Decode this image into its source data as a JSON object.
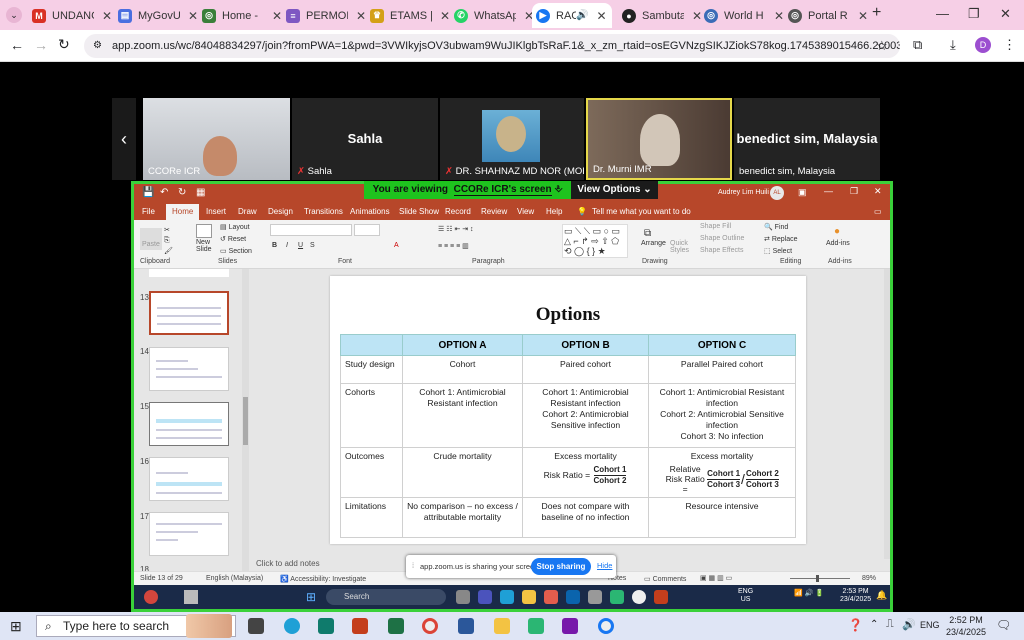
{
  "browser": {
    "tabs": [
      {
        "label": "UNDANG",
        "icon": "gmail-icon",
        "color": "#d93025"
      },
      {
        "label": "MyGovU",
        "icon": "doc-icon",
        "color": "#4a6ee0"
      },
      {
        "label": "Home -",
        "icon": "globe-icon",
        "color": "#3a7f3a"
      },
      {
        "label": "PERMOH",
        "icon": "forms-icon",
        "color": "#7e57c2"
      },
      {
        "label": "ETAMS |",
        "icon": "crown-icon",
        "color": "#d4a017"
      },
      {
        "label": "WhatsAp",
        "icon": "whatsapp-icon",
        "color": "#25d366"
      },
      {
        "label": "RACI",
        "icon": "zoom-icon",
        "color": "#1877f2"
      },
      {
        "label": "Sambuta",
        "icon": "github-icon",
        "color": "#222222"
      },
      {
        "label": "World H",
        "icon": "globe-icon",
        "color": "#3b6cb7"
      },
      {
        "label": "Portal R",
        "icon": "globe-icon",
        "color": "#555555"
      }
    ],
    "new_tab": "+",
    "url": "app.zoom.us/wc/84048834297/join?fromPWA=1&pwd=3VWIkyjsOV3ubwam9WuJIKlgbTsRaF.1&_x_zm_rtaid=osEGVNzgSIKJZiokS78kog.1745389015466.2c003cf0414f88e...",
    "profile_initial": "D"
  },
  "zoom": {
    "participants": [
      {
        "name": "CCORe ICR",
        "big": ""
      },
      {
        "name": "Sahla",
        "big": "Sahla"
      },
      {
        "name": "DR. SHAHNAZ MD NOR (MOH)",
        "big": ""
      },
      {
        "name": "Dr. Murni IMR",
        "big": ""
      },
      {
        "name": "benedict sim, Malaysia",
        "big": "benedict sim, Malaysia"
      }
    ],
    "banner_prefix": "You are viewing",
    "banner_name": "CCORe ICR's screen",
    "view_options": "View Options",
    "share_text": "app.zoom.us is sharing your screen.",
    "stop_sharing": "Stop sharing",
    "hide": "Hide"
  },
  "ppt": {
    "user": "Audrey Lim Huili",
    "user_initial": "AL",
    "tabs": [
      "File",
      "Home",
      "Insert",
      "Draw",
      "Design",
      "Transitions",
      "Animations",
      "Slide Show",
      "Record",
      "Review",
      "View",
      "Help"
    ],
    "tell_me": "Tell me what you want to do",
    "groups": [
      "Clipboard",
      "Slides",
      "Font",
      "Paragraph",
      "Drawing",
      "Editing",
      "Add-ins"
    ],
    "buttons": {
      "paste": "Paste",
      "new_slide": "New Slide",
      "layout": "Layout",
      "reset": "Reset",
      "section": "Section",
      "arrange": "Arrange",
      "quick_styles": "Quick Styles",
      "shape_fill": "Shape Fill",
      "shape_outline": "Shape Outline",
      "shape_effects": "Shape Effects",
      "find": "Find",
      "replace": "Replace",
      "select": "Select",
      "addins": "Add-ins"
    },
    "thumb_numbers": [
      "13",
      "14",
      "15",
      "16",
      "17",
      "18"
    ],
    "notes_placeholder": "Click to add notes",
    "status": {
      "slide": "Slide 13 of 29",
      "lang": "English (Malaysia)",
      "accessibility": "Accessibility: Investigate",
      "notes": "Notes",
      "comments": "Comments",
      "zoom": "89%"
    },
    "inner_clock": {
      "time": "2:53 PM",
      "date": "23/4/2025",
      "lang1": "ENG",
      "lang2": "US"
    },
    "inner_search": "Search"
  },
  "slide": {
    "title": "Options",
    "headers": [
      "",
      "OPTION A",
      "OPTION B",
      "OPTION C"
    ],
    "rows": [
      {
        "label": "Study design",
        "a": "Cohort",
        "b": "Paired cohort",
        "c": "Parallel Paired cohort"
      },
      {
        "label": "Cohorts",
        "a": "Cohort 1: Antimicrobial Resistant infection",
        "b1": "Cohort 1: Antimicrobial Resistant infection",
        "b2": "Cohort 2: Antimicrobial Sensitive infection",
        "c1": "Cohort 1: Antimicrobial Resistant infection",
        "c2": "Cohort 2: Antimicrobial Sensitive infection",
        "c3": "Cohort 3: No infection"
      },
      {
        "label": "Outcomes",
        "a": "Crude mortality",
        "b": "Excess mortality",
        "b_formula": "Risk Ratio =",
        "b_num": "Cohort 1",
        "b_den": "Cohort 2",
        "c": "Excess mortality",
        "c_formula": "Relative Risk Ratio =",
        "c_num1": "Cohort 1",
        "c_den1": "Cohort 3",
        "c_num2": "Cohort 2",
        "c_den2": "Cohort 3",
        "slash": "/"
      },
      {
        "label": "Limitations",
        "a": "No comparison – no excess / attributable mortality",
        "b": "Does not compare with baseline of no infection",
        "c": "Resource intensive"
      }
    ]
  },
  "taskbar": {
    "search": "Type here to search",
    "time": "2:52 PM",
    "date": "23/4/2025",
    "lang": "ENG"
  }
}
